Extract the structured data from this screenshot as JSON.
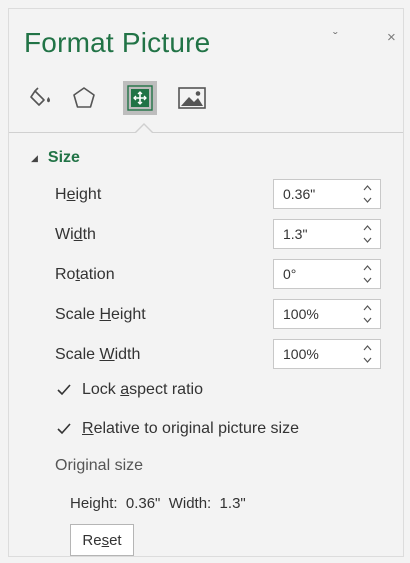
{
  "pane": {
    "title": "Format Picture",
    "pin_glyph": "ˇ",
    "close_glyph": "×"
  },
  "tabs": [
    {
      "icon": "fill-bucket-icon",
      "active": false
    },
    {
      "icon": "pentagon-effects-icon",
      "active": false
    },
    {
      "icon": "size-properties-icon",
      "active": true
    },
    {
      "icon": "picture-icon",
      "active": false
    }
  ],
  "section": {
    "title": "Size",
    "expanded": true
  },
  "fields": {
    "height": {
      "label_pre": "H",
      "label_ul": "e",
      "label_post": "ight",
      "value": "0.36\""
    },
    "width": {
      "label_pre": "Wi",
      "label_ul": "d",
      "label_post": "th",
      "value": "1.3\""
    },
    "rotation": {
      "label_pre": "Ro",
      "label_ul": "t",
      "label_post": "ation",
      "value": "0°"
    },
    "scale_height": {
      "label_pre": "Scale ",
      "label_ul": "H",
      "label_post": "eight",
      "value": "100%"
    },
    "scale_width": {
      "label_pre": "Scale ",
      "label_ul": "W",
      "label_post": "idth",
      "value": "100%"
    }
  },
  "checks": {
    "lock": {
      "label_pre": "Lock ",
      "label_ul": "a",
      "label_post": "spect ratio",
      "checked": true
    },
    "relative": {
      "label_pre": "",
      "label_ul": "R",
      "label_post": "elative to original picture size",
      "checked": true
    }
  },
  "original": {
    "label": "Original size",
    "values": "Height:  0.36\"  Width:  1.3\""
  },
  "reset": {
    "label_pre": "Re",
    "label_ul": "s",
    "label_post": "et"
  },
  "colors": {
    "accent": "#217346",
    "active_tab": "#bdbdbd",
    "background": "#f3f3f3"
  }
}
